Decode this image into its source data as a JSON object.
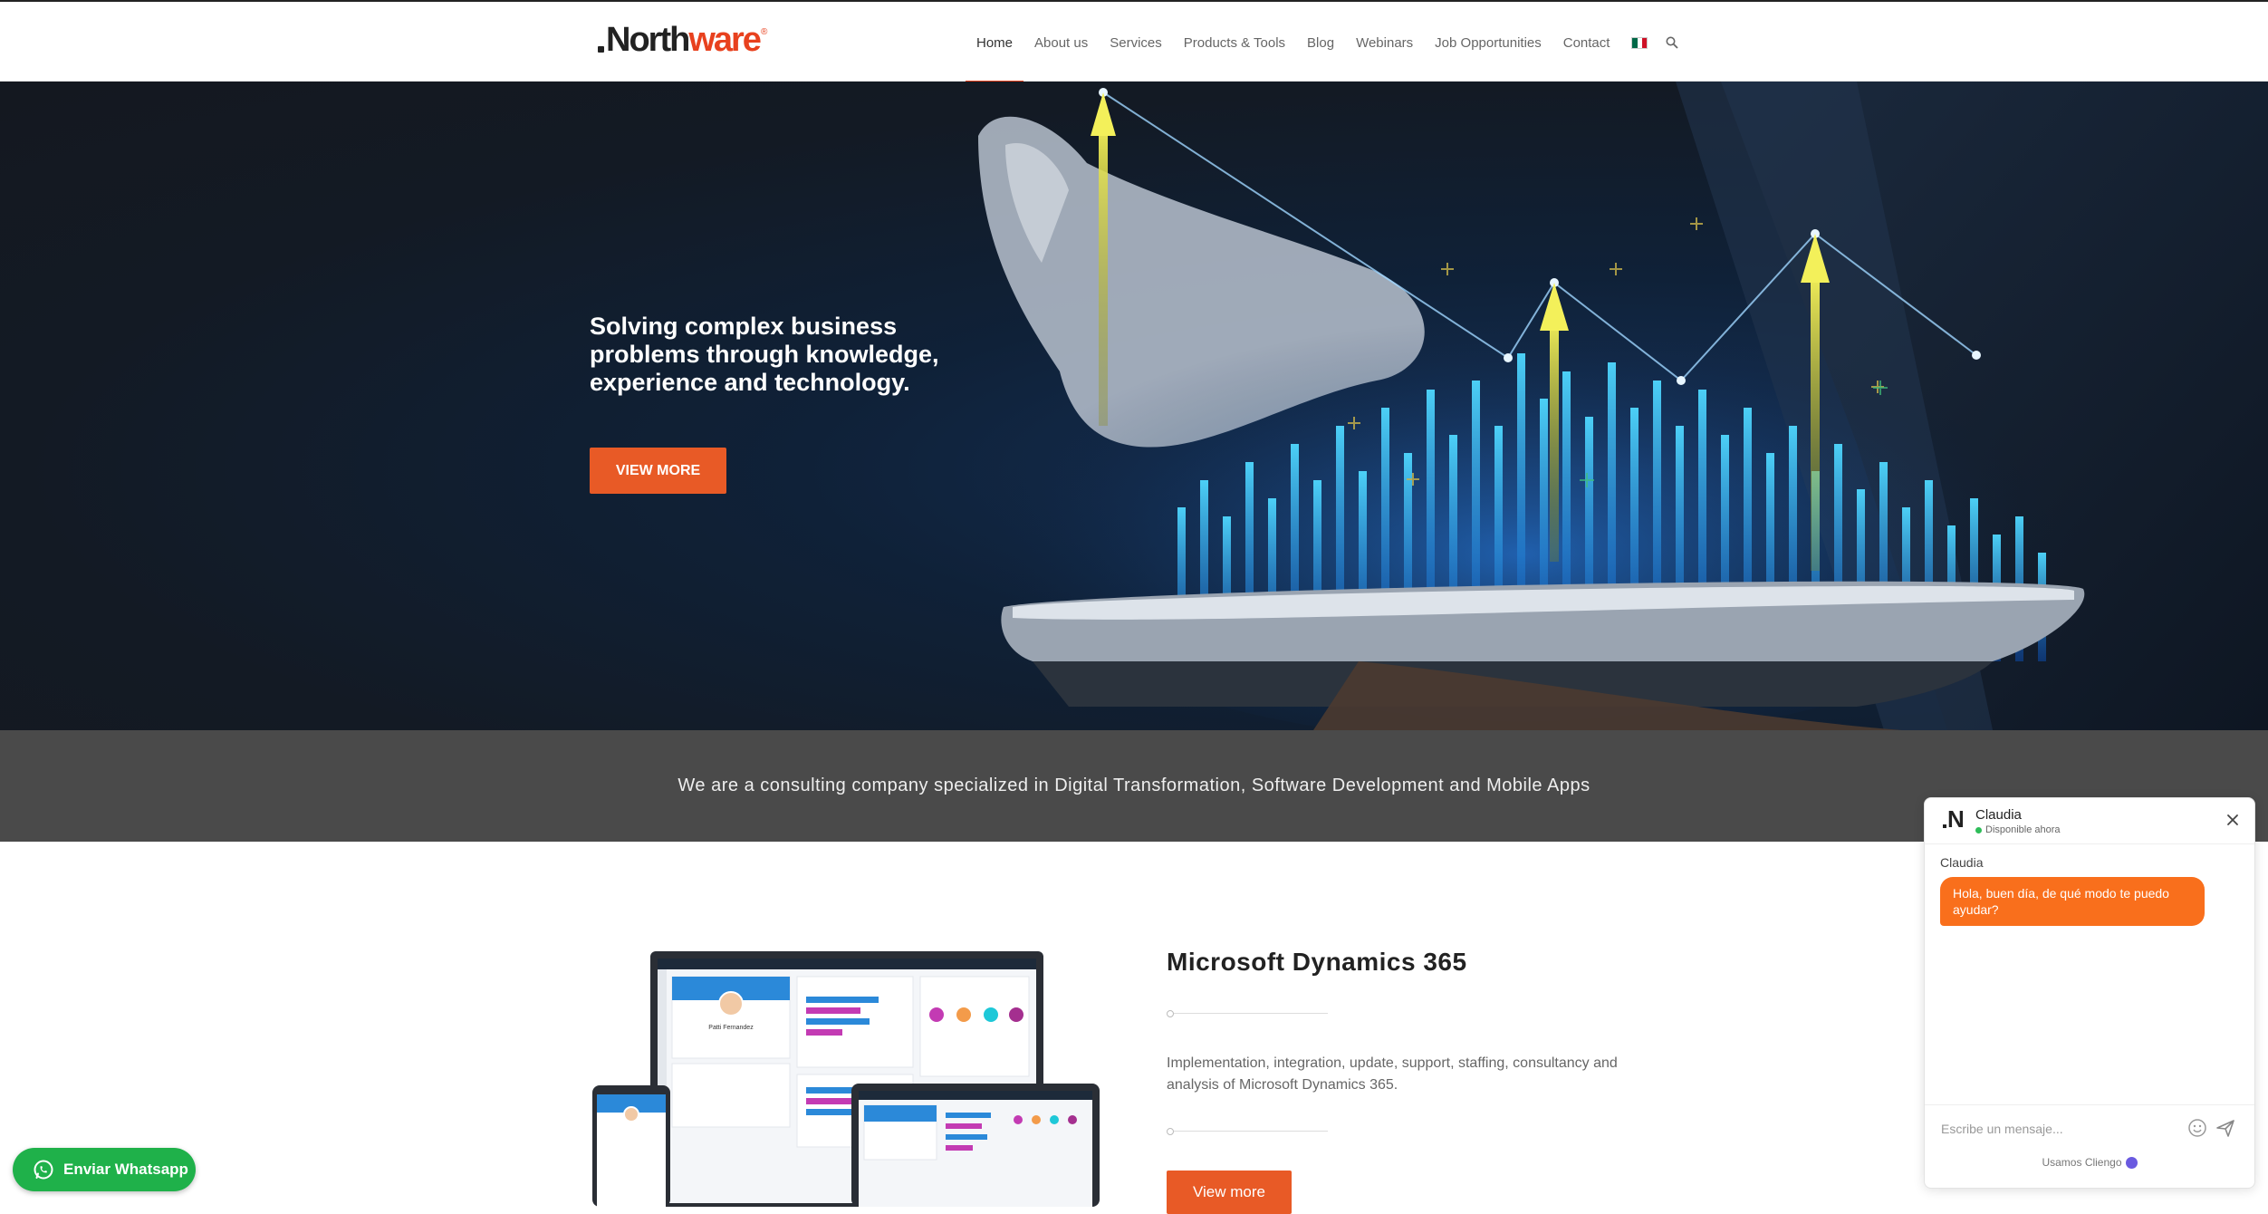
{
  "colors": {
    "accent": "#e85a26",
    "brand_orange": "#e8411e",
    "whatsapp": "#1fb14a",
    "band": "#4a4a4a",
    "chat_bubble": "#f96f1c"
  },
  "header": {
    "logo": {
      "prefix": ".",
      "part1": "North",
      "part2": "ware",
      "reg": "®"
    },
    "nav": [
      "Home",
      "About us",
      "Services",
      "Products & Tools",
      "Blog",
      "Webinars",
      "Job Opportunities",
      "Contact"
    ],
    "active_index": 0,
    "flag_icon": "mexico-flag-icon",
    "search_icon": "search-icon"
  },
  "hero": {
    "title": "Solving complex business problems through knowledge, experience and technology.",
    "button": "VIEW MORE"
  },
  "band": {
    "text": "We are a consulting company specialized in Digital Transformation, Software Development and Mobile Apps"
  },
  "section": {
    "title": "Microsoft Dynamics 365",
    "description": "Implementation, integration, update, support, staffing, consultancy and analysis of Microsoft Dynamics 365.",
    "button": "View more"
  },
  "devices_mock": {
    "profile_name": "Patti Fernandez"
  },
  "whatsapp": {
    "label": "Enviar Whatsapp",
    "icon": "whatsapp-icon"
  },
  "chat": {
    "avatar_letter": "N",
    "agent_name": "Claudia",
    "status": "Disponible ahora",
    "sender": "Claudia",
    "message": "Hola, buen día, de qué modo te puedo ayudar?",
    "placeholder": "Escribe un mensaje...",
    "footer": "Usamos Cliengo"
  }
}
